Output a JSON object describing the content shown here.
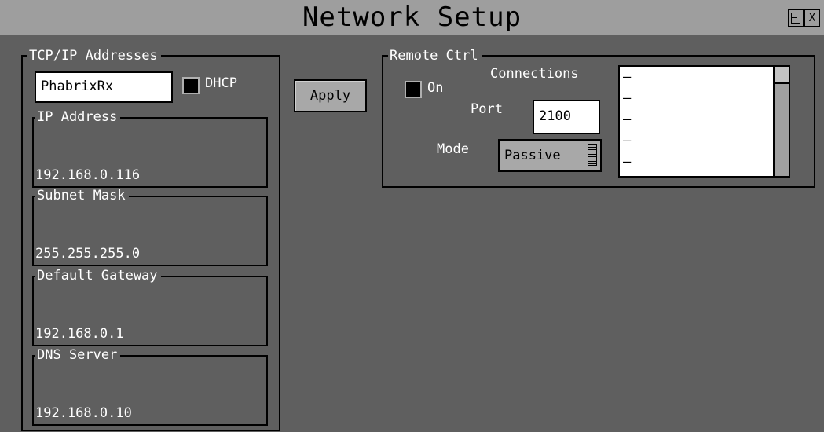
{
  "window": {
    "title": "Network Setup",
    "restore_icon": "restore-icon",
    "close_icon": "close-icon",
    "close_glyph": "X"
  },
  "tcpip": {
    "legend": "TCP/IP Addresses",
    "hostname": "PhabrixRx",
    "dhcp_label": "DHCP",
    "dhcp_checked": false,
    "ip": {
      "legend": "IP Address",
      "value": "192.168.0.116"
    },
    "subnet": {
      "legend": "Subnet Mask",
      "value": "255.255.255.0"
    },
    "gateway": {
      "legend": "Default Gateway",
      "value": "192.168.0.1"
    },
    "dns": {
      "legend": "DNS Server",
      "value": "192.168.0.10"
    }
  },
  "apply_label": "Apply",
  "remote": {
    "legend": "Remote Ctrl",
    "on_label": "On",
    "on_checked": false,
    "connections_label": "Connections",
    "port_label": "Port",
    "port_value": "2100",
    "mode_label": "Mode",
    "mode_value": "Passive",
    "connections": [
      "–",
      "–",
      "–",
      "–",
      "–"
    ]
  }
}
